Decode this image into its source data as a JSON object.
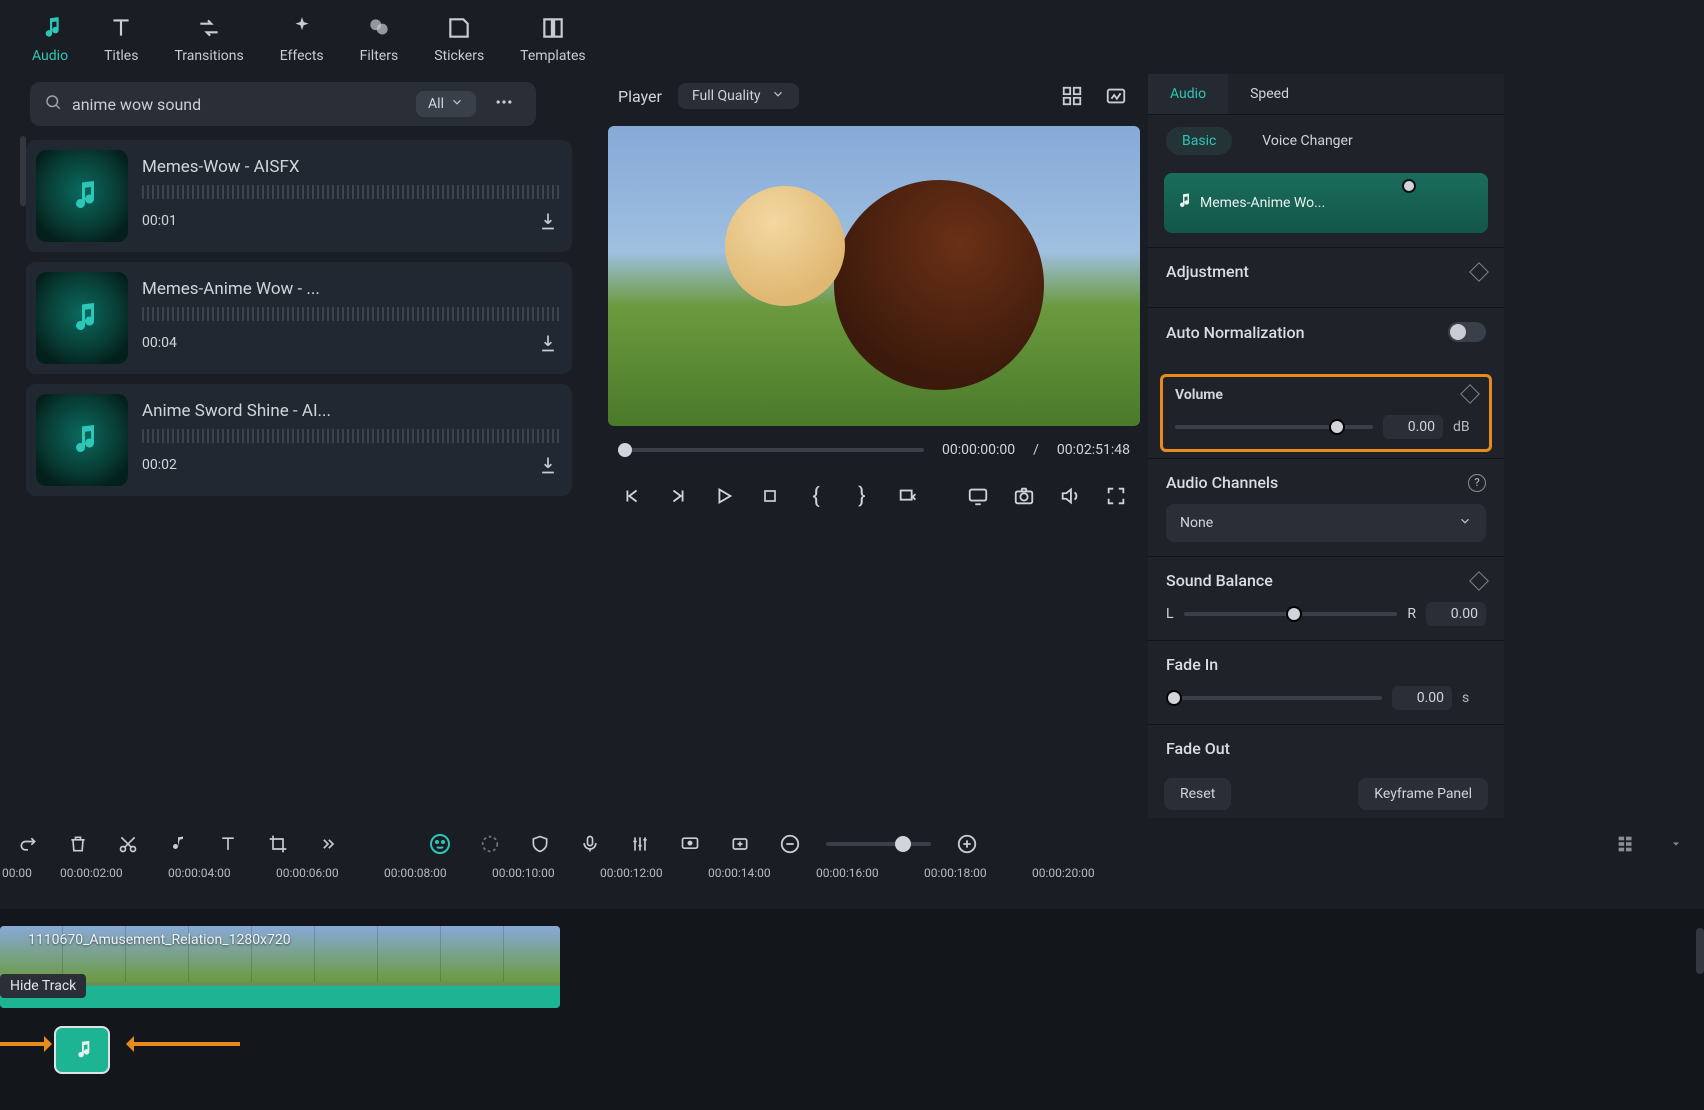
{
  "topnav": {
    "tabs": [
      {
        "id": "audio",
        "label": "Audio",
        "active": true
      },
      {
        "id": "titles",
        "label": "Titles"
      },
      {
        "id": "transitions",
        "label": "Transitions"
      },
      {
        "id": "effects",
        "label": "Effects"
      },
      {
        "id": "filters",
        "label": "Filters"
      },
      {
        "id": "stickers",
        "label": "Stickers"
      },
      {
        "id": "templates",
        "label": "Templates"
      }
    ]
  },
  "search": {
    "value": "anime wow sound",
    "filter": "All"
  },
  "audio_results": [
    {
      "title": "Memes-Wow - AISFX",
      "duration": "00:01"
    },
    {
      "title": "Memes-Anime Wow - ...",
      "duration": "00:04"
    },
    {
      "title": "Anime Sword Shine - AI...",
      "duration": "00:02"
    }
  ],
  "player": {
    "label": "Player",
    "quality": "Full Quality",
    "current": "00:00:00:00",
    "sep": "/",
    "total": "00:02:51:48"
  },
  "rtabs": {
    "audio": "Audio",
    "speed": "Speed"
  },
  "rsub": {
    "basic": "Basic",
    "voice": "Voice Changer"
  },
  "clip": {
    "name": "Memes-Anime Wo..."
  },
  "adjustment": {
    "title": "Adjustment"
  },
  "auto_norm": {
    "label": "Auto Normalization"
  },
  "volume": {
    "label": "Volume",
    "value": "0.00",
    "unit": "dB"
  },
  "channels": {
    "label": "Audio Channels",
    "value": "None"
  },
  "balance": {
    "label": "Sound Balance",
    "left": "L",
    "right": "R",
    "value": "0.00"
  },
  "fadein": {
    "label": "Fade In",
    "value": "0.00",
    "unit": "s"
  },
  "fadeout": {
    "label": "Fade Out"
  },
  "buttons": {
    "reset": "Reset",
    "keyframe": "Keyframe Panel"
  },
  "ruler": [
    "00:00",
    "00:00:02:00",
    "00:00:04:00",
    "00:00:06:00",
    "00:00:08:00",
    "00:00:10:00",
    "00:00:12:00",
    "00:00:14:00",
    "00:00:16:00",
    "00:00:18:00",
    "00:00:20:00"
  ],
  "videotrack": {
    "label": "1110670_Amusement_Relation_1280x720"
  },
  "hidebadge": "Hide Track"
}
